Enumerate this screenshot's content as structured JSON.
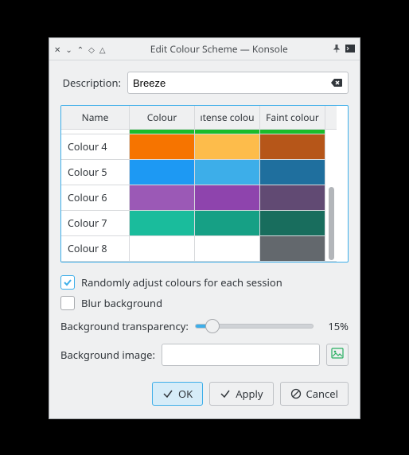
{
  "window": {
    "title": "Edit Colour Scheme — Konsole"
  },
  "description": {
    "label": "Description:",
    "value": "Breeze"
  },
  "table": {
    "headers": [
      "Name",
      "Colour",
      "Intense colour",
      "Faint colour"
    ],
    "header_display": [
      "Name",
      "Colour",
      "ıtense colou",
      "Faint colour"
    ],
    "rows": [
      {
        "name": "",
        "colour": "#1abc2a",
        "intense": "#1abc2a",
        "faint": "#1abc2a"
      },
      {
        "name": "Colour 4",
        "colour": "#f67400",
        "intense": "#fdbc4b",
        "faint": "#b65619"
      },
      {
        "name": "Colour 5",
        "colour": "#1d99f3",
        "intense": "#3daee9",
        "faint": "#1f6f9e"
      },
      {
        "name": "Colour 6",
        "colour": "#9b59b6",
        "intense": "#8e44ad",
        "faint": "#614a73"
      },
      {
        "name": "Colour 7",
        "colour": "#1abc9c",
        "intense": "#16a085",
        "faint": "#186d5d"
      },
      {
        "name": "Colour 8",
        "colour": "#ffffff",
        "intense": "#ffffff",
        "faint": "#63686d"
      }
    ]
  },
  "random_checkbox": {
    "label": "Randomly adjust colours for each session",
    "checked": true
  },
  "blur_checkbox": {
    "label": "Blur background",
    "checked": false
  },
  "transparency": {
    "label": "Background transparency:",
    "percent": 15,
    "display": "15%"
  },
  "background_image": {
    "label": "Background image:",
    "value": ""
  },
  "buttons": {
    "ok": "OK",
    "apply": "Apply",
    "cancel": "Cancel"
  }
}
